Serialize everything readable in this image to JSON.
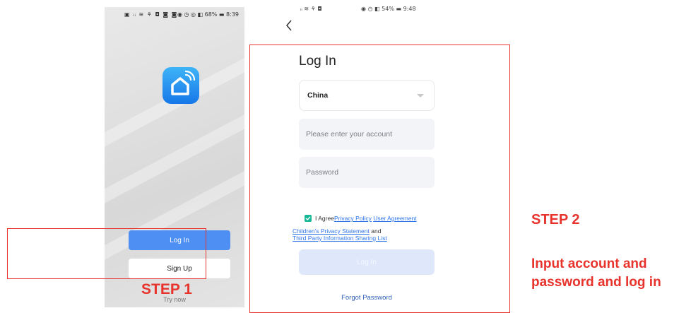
{
  "left_phone": {
    "status_left": "▣ ᵢᵢ ≋ ⚘ ◘ ◙ ◙",
    "status_right": "◉ ◷ ◎ ◧ 68% ▬ 8:39",
    "login_label": "Log In",
    "signup_label": "Sign Up",
    "try_now": "Try now"
  },
  "right_phone": {
    "status_left": "ᵢᵢ ≋ ⚘ ◘",
    "status_right": "◉ ◷ ◧ 54% ▬ 9:48",
    "title": "Log In",
    "country": "China",
    "account_placeholder": "Please enter your account",
    "password_placeholder": "Password",
    "agree_text": "I Agree",
    "privacy_policy": "Privacy Policy",
    "user_agreement": "User Agreement",
    "childrens_privacy": "Children's Privacy Statement",
    "and_text": "and",
    "third_party": "Third Party Information Sharing List",
    "login_button": "Log In",
    "forgot_password": "Forgot Password"
  },
  "annotations": {
    "step1": "STEP 1",
    "step2": "STEP 2",
    "step2_line1": "Input account and",
    "step2_line2": "password and log in"
  },
  "colors": {
    "annotation_red": "#e8322c",
    "primary_blue": "#4d8ff2",
    "link_blue": "#2f76e9",
    "checkbox_green": "#17b897"
  }
}
